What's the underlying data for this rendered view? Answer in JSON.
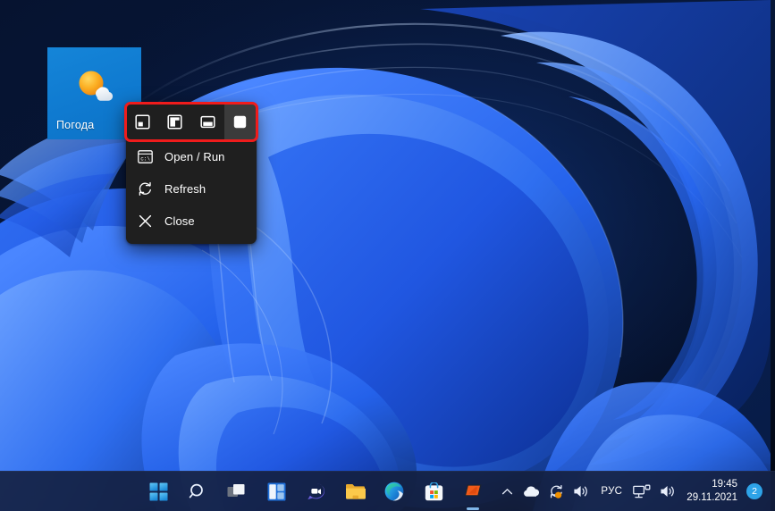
{
  "desktop": {
    "icon": {
      "label": "Погода",
      "icon_name": "weather-sun-cloud-icon",
      "tile_color": "#0f7ad0"
    },
    "wallpaper_name": "windows-11-bloom-wallpaper",
    "background_color": "#071431"
  },
  "context_menu": {
    "size_options": [
      {
        "name": "size-small-icon",
        "label": "Small",
        "selected": false
      },
      {
        "name": "size-medium-icon",
        "label": "Medium",
        "selected": false
      },
      {
        "name": "size-wide-icon",
        "label": "Wide",
        "selected": false
      },
      {
        "name": "size-large-icon",
        "label": "Large",
        "selected": true
      }
    ],
    "items": [
      {
        "label": "Open / Run",
        "icon_name": "console-window-icon"
      },
      {
        "label": "Refresh",
        "icon_name": "refresh-icon"
      },
      {
        "label": "Close",
        "icon_name": "close-x-icon"
      }
    ],
    "background_color": "#1f1f1f",
    "selected_background_color": "#3b3b3b"
  },
  "annotation": {
    "highlight_color": "#ef1c1c",
    "highlight_label": "size-selector-highlight"
  },
  "taskbar": {
    "buttons": [
      {
        "name": "start-button",
        "label": "Start"
      },
      {
        "name": "search-button",
        "label": "Search"
      },
      {
        "name": "task-view-button",
        "label": "Task View"
      },
      {
        "name": "widgets-button",
        "label": "Widgets"
      },
      {
        "name": "chat-teams-button",
        "label": "Chat"
      },
      {
        "name": "file-explorer-button",
        "label": "File Explorer"
      },
      {
        "name": "microsoft-edge-button",
        "label": "Microsoft Edge"
      },
      {
        "name": "microsoft-store-button",
        "label": "Microsoft Store"
      },
      {
        "name": "app-button",
        "label": "App"
      }
    ],
    "tray": {
      "show_hidden_icons_label": "Show hidden icons",
      "onedrive_label": "OneDrive",
      "update_label": "Windows Update",
      "volume_label": "Volume",
      "language": "РУС",
      "network_label": "Network",
      "sound_label": "Sound",
      "time": "19:45",
      "date": "29.11.2021",
      "notification_count": "2"
    }
  }
}
